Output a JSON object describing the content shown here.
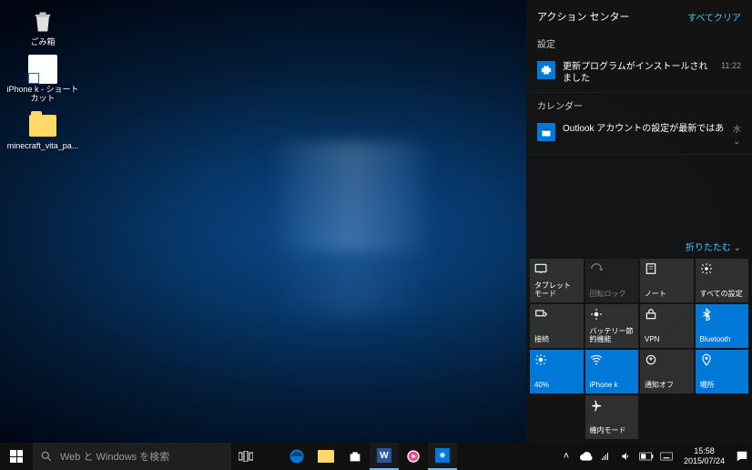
{
  "desktop": {
    "icons": [
      {
        "name": "recycle-bin",
        "label": "ごみ箱"
      },
      {
        "name": "shortcut",
        "label": "iPhone k - ショートカット"
      },
      {
        "name": "folder",
        "label": "minecraft_vita_pa..."
      }
    ]
  },
  "taskbar": {
    "search_placeholder": "Web と Windows を検索",
    "clock_time": "15:58",
    "clock_date": "2015/07/24"
  },
  "action_center": {
    "title": "アクション センター",
    "clear_all": "すべてクリア",
    "collapse": "折りたたむ",
    "sections": [
      {
        "title": "設定",
        "items": [
          {
            "icon": "gear",
            "text": "更新プログラムがインストールされました",
            "time": "11:22"
          }
        ]
      },
      {
        "title": "カレンダー",
        "items": [
          {
            "icon": "calendar",
            "text": "Outlook アカウントの設定が最新ではあ",
            "time": "水"
          }
        ]
      }
    ],
    "quick_actions": [
      {
        "label": "タブレット モード",
        "icon": "tablet",
        "active": false
      },
      {
        "label": "回転ロック",
        "icon": "rotation",
        "active": false,
        "disabled": true
      },
      {
        "label": "ノート",
        "icon": "note",
        "active": false
      },
      {
        "label": "すべての設定",
        "icon": "settings",
        "active": false
      },
      {
        "label": "接続",
        "icon": "connect",
        "active": false
      },
      {
        "label": "バッテリー節約機能",
        "icon": "battery-saver",
        "active": false
      },
      {
        "label": "VPN",
        "icon": "vpn",
        "active": false
      },
      {
        "label": "Bluetooth",
        "icon": "bluetooth",
        "active": true
      },
      {
        "label": "40%",
        "icon": "brightness",
        "active": true
      },
      {
        "label": "iPhone k",
        "icon": "wifi",
        "active": true
      },
      {
        "label": "通知オフ",
        "icon": "quiet",
        "active": false
      },
      {
        "label": "場所",
        "icon": "location",
        "active": true
      },
      {
        "label": "",
        "icon": "",
        "active": false,
        "empty": true
      },
      {
        "label": "機内モード",
        "icon": "airplane",
        "active": false
      },
      {
        "label": "",
        "icon": "",
        "active": false,
        "empty": true
      },
      {
        "label": "",
        "icon": "",
        "active": false,
        "empty": true
      }
    ]
  }
}
